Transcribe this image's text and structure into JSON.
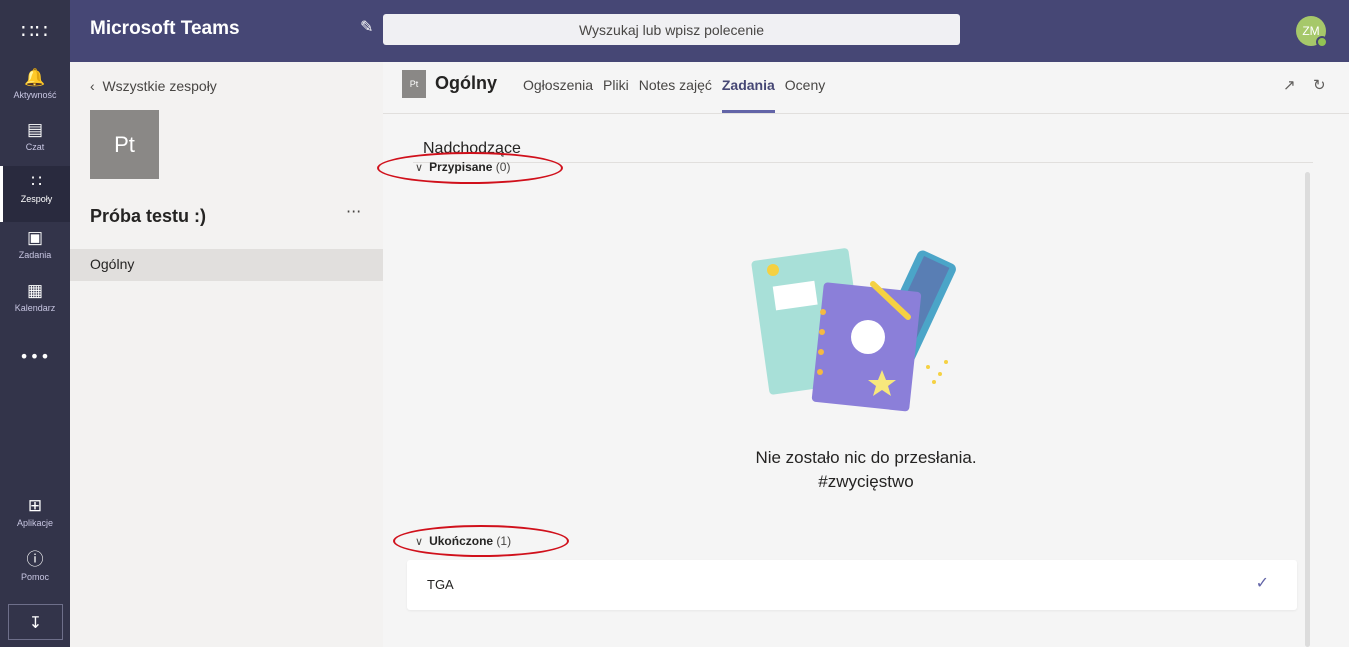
{
  "app": {
    "name": "Microsoft Teams"
  },
  "search": {
    "placeholder": "Wyszukaj lub wpisz polecenie"
  },
  "user": {
    "initials": "ZM"
  },
  "rail": {
    "items": [
      {
        "label": "Aktywność",
        "icon": "bell-icon"
      },
      {
        "label": "Czat",
        "icon": "chat-icon"
      },
      {
        "label": "Zespoły",
        "icon": "teams-icon"
      },
      {
        "label": "Zadania",
        "icon": "assignments-icon"
      },
      {
        "label": "Kalendarz",
        "icon": "calendar-icon"
      }
    ],
    "more": "•••",
    "bottom": [
      {
        "label": "Aplikacje",
        "icon": "apps-icon"
      },
      {
        "label": "Pomoc",
        "icon": "help-icon"
      }
    ]
  },
  "team": {
    "back_label": "Wszystkie zespoły",
    "tile_initials": "Pt",
    "name": "Próba testu :)",
    "more": "···",
    "channels": [
      "Ogólny"
    ]
  },
  "channel": {
    "badge": "Pt",
    "title": "Ogólny",
    "tabs": [
      "Ogłoszenia",
      "Pliki",
      "Notes zajęć",
      "Zadania",
      "Oceny"
    ],
    "active_tab": "Zadania"
  },
  "assignments": {
    "section_title": "Nadchodzące",
    "assigned": {
      "label": "Przypisane",
      "count": "(0)"
    },
    "empty_line1": "Nie zostało nic do przesłania.",
    "empty_line2": "#zwycięstwo",
    "completed": {
      "label": "Ukończone",
      "count": "(1)"
    },
    "items": [
      {
        "title": "TGA",
        "status_icon": "check-icon"
      }
    ]
  },
  "colors": {
    "accent": "#6264a7",
    "topbar": "#464775",
    "rail": "#33344a",
    "annotation": "#d0101b"
  }
}
